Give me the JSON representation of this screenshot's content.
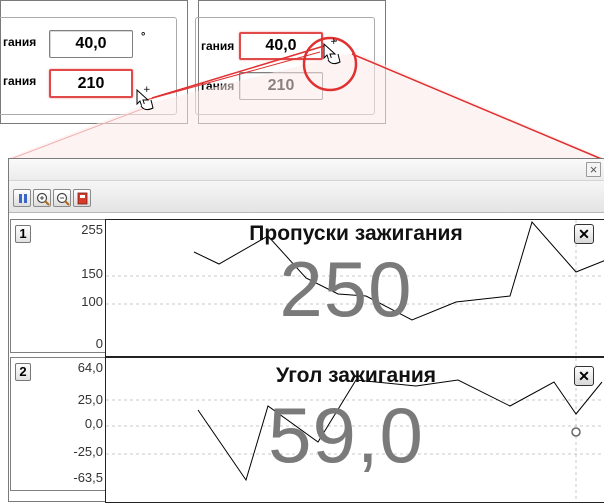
{
  "snippet_left": {
    "label_top": "гания",
    "value_top": "40,0",
    "unit_top": "°",
    "label_bottom": "гания",
    "value_bottom": "210"
  },
  "snippet_right": {
    "label_top": "гания",
    "value_top": "40,0",
    "unit_top": "°",
    "label_bottom": "гания",
    "value_bottom": "210"
  },
  "window": {
    "close_glyph": "×",
    "toolbar": [
      {
        "name": "pause-button",
        "icon": "pause-icon"
      },
      {
        "name": "zoom-in-button",
        "icon": "zoom-in-icon"
      },
      {
        "name": "zoom-out-button",
        "icon": "zoom-out-icon"
      },
      {
        "name": "export-button",
        "icon": "export-icon"
      }
    ]
  },
  "channels": [
    {
      "index": "1",
      "title": "Пропуски зажигания",
      "value": "250",
      "close_glyph": "✕",
      "ticks": [
        "255",
        "150",
        "100",
        "0"
      ]
    },
    {
      "index": "2",
      "title": "Угол зажигания",
      "value": "59,0",
      "close_glyph": "✕",
      "ticks": [
        "64,0",
        "25,0",
        "0,0",
        "-25,0",
        "-63,5"
      ]
    }
  ],
  "colors": {
    "highlight": "#e24a4a",
    "callout": "#e03030",
    "grid": "#c8c8c8",
    "trace": "#000000",
    "big_value": "#7a7a7a"
  }
}
